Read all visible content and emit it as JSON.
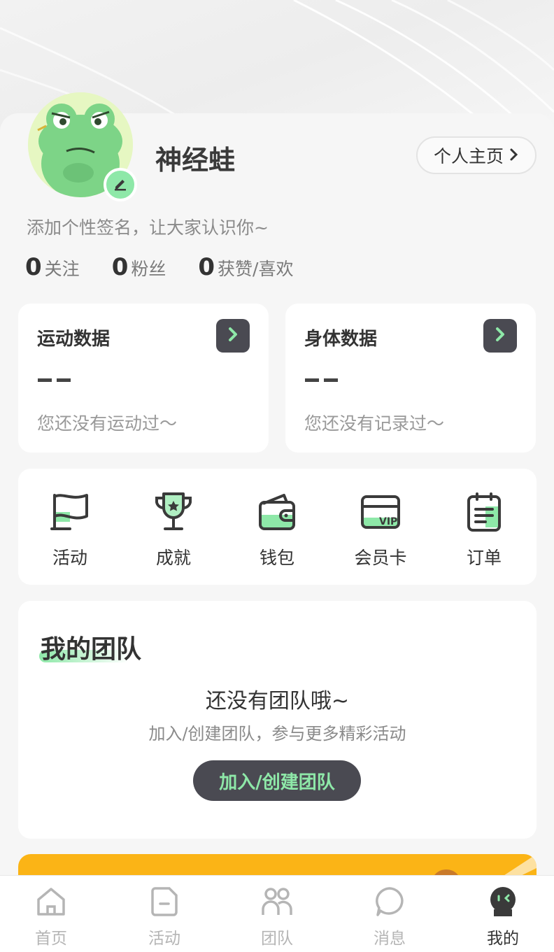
{
  "profile": {
    "username": "神经蛙",
    "home_button": "个人主页",
    "signature": "添加个性签名，让大家认识你~",
    "stats": [
      {
        "num": "0",
        "label": "关注"
      },
      {
        "num": "0",
        "label": "粉丝"
      },
      {
        "num": "0",
        "label": "获赞/喜欢"
      }
    ]
  },
  "data_cards": [
    {
      "title": "运动数据",
      "value": "--",
      "hint": "您还没有运动过～"
    },
    {
      "title": "身体数据",
      "value": "--",
      "hint": "您还没有记录过～"
    }
  ],
  "menu": [
    {
      "label": "活动",
      "icon": "flag-icon"
    },
    {
      "label": "成就",
      "icon": "trophy-icon"
    },
    {
      "label": "钱包",
      "icon": "wallet-icon"
    },
    {
      "label": "会员卡",
      "icon": "vip-card-icon",
      "badge": "VIP"
    },
    {
      "label": "订单",
      "icon": "order-clipboard-icon"
    }
  ],
  "team": {
    "title": "我的团队",
    "empty": "还没有团队哦~",
    "sub": "加入/创建团队，参与更多精彩活动",
    "button": "加入/创建团队"
  },
  "tabs": [
    {
      "label": "首页",
      "icon": "home-icon",
      "active": false
    },
    {
      "label": "活动",
      "icon": "activity-icon",
      "active": false
    },
    {
      "label": "团队",
      "icon": "team-icon",
      "active": false
    },
    {
      "label": "消息",
      "icon": "message-icon",
      "active": false
    },
    {
      "label": "我的",
      "icon": "profile-icon",
      "active": true
    }
  ],
  "colors": {
    "accent": "#8ee8a8",
    "dark": "#4a4a52",
    "banner": "#fbb416"
  }
}
